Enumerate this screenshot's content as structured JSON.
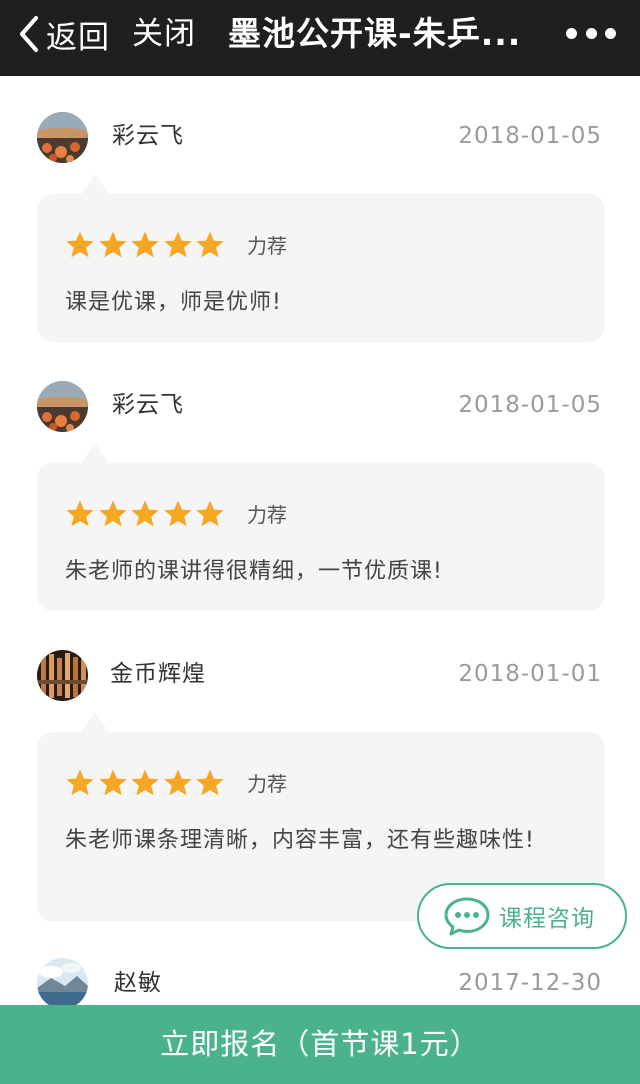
{
  "header": {
    "back_label": "返回",
    "close_label": "关闭",
    "title": "墨池公开课-朱乒..."
  },
  "reviews": [
    {
      "user": "彩云飞",
      "date": "2018-01-05",
      "rating": 5,
      "tag": "力荐",
      "text": "课是优课，师是优师!"
    },
    {
      "user": "彩云飞",
      "date": "2018-01-05",
      "rating": 5,
      "tag": "力荐",
      "text": "朱老师的课讲得很精细，一节优质课!"
    },
    {
      "user": "金币辉煌",
      "date": "2018-01-01",
      "rating": 5,
      "tag": "力荐",
      "text": "朱老师课条理清晰，内容丰富，还有些趣味性!"
    },
    {
      "user": "赵敏",
      "date": "2017-12-30"
    }
  ],
  "consult_label": "课程咨询",
  "enroll_label": "立即报名（首节课1元）",
  "colors": {
    "accent": "#4ab38c",
    "star": "#f5a623",
    "topbar": "#1f1f1f",
    "card": "#f5f5f5"
  }
}
